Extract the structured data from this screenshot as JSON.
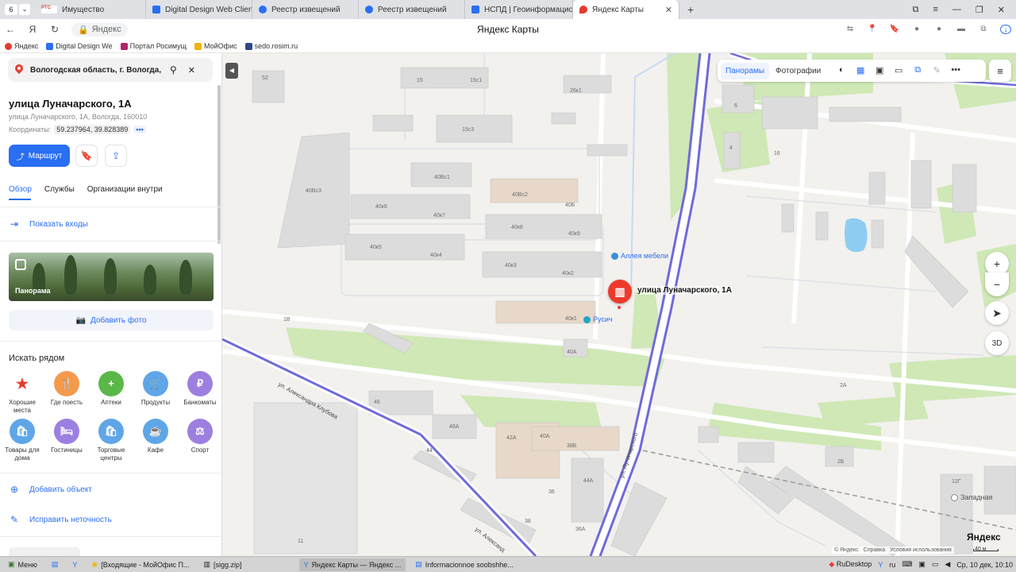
{
  "browser": {
    "tab_count": "6",
    "tabs": [
      {
        "label": "Имущество",
        "icon_color": "#d83a2b",
        "icon_text": "РТС"
      },
      {
        "label": "Digital Design Web Client",
        "icon_color": "#2a6ef2"
      },
      {
        "label": "Реестр извещений",
        "icon_color": "#2a6ef2"
      },
      {
        "label": "Реестр извещений",
        "icon_color": "#2a6ef2"
      },
      {
        "label": "НСПД | Геоинформацион",
        "icon_color": "#2a6ef2"
      },
      {
        "label": "Яндекс Карты",
        "icon_color": "#e63a2e"
      }
    ],
    "domain": "Яндекс",
    "page_title": "Яндекс Карты",
    "bookmarks": [
      {
        "label": "Яндекс",
        "color": "#e63a2e"
      },
      {
        "label": "Digital Design We",
        "color": "#2a6ef2"
      },
      {
        "label": "Портал Росимущ",
        "color": "#b0246a"
      },
      {
        "label": "МойОфис",
        "color": "#f0b400"
      },
      {
        "label": "sedo.rosim.ru",
        "color": "#2b4a8a"
      }
    ]
  },
  "sidebar": {
    "search_value": "Вологодская область, г. Вологда, ул.",
    "title": "улица Луначарского, 1А",
    "subaddress": "улица Луначарского, 1А, Вологда, 160010",
    "coords_label": "Координаты:",
    "coords_value": "59.237964, 39.828389",
    "coords_more": "•••",
    "route_label": "Маршрут",
    "tabs": [
      "Обзор",
      "Службы",
      "Организации внутри"
    ],
    "show_entrances": "Показать входы",
    "panorama_label": "Панорама",
    "add_photo": "Добавить фото",
    "nearby_title": "Искать рядом",
    "categories": [
      {
        "label": "Хорошие места",
        "color": "#ffffff",
        "glyph": "★"
      },
      {
        "label": "Где поесть",
        "color": "#f39a4c",
        "glyph": "🍴"
      },
      {
        "label": "Аптеки",
        "color": "#59b847",
        "glyph": "+"
      },
      {
        "label": "Продукты",
        "color": "#5fa6e8",
        "glyph": "🛒"
      },
      {
        "label": "Банкоматы",
        "color": "#9c7fe0",
        "glyph": "₽"
      },
      {
        "label": "Товары для дома",
        "color": "#5fa6e8",
        "glyph": "🛍"
      },
      {
        "label": "Гостиницы",
        "color": "#9c7fe0",
        "glyph": "🛏"
      },
      {
        "label": "Торговые центры",
        "color": "#5fa6e8",
        "glyph": "🛍"
      },
      {
        "label": "Кафе",
        "color": "#5fa6e8",
        "glyph": "☕"
      },
      {
        "label": "Спорт",
        "color": "#9c7fe0",
        "glyph": "⚖"
      }
    ],
    "add_object": "Добавить объект",
    "fix_error": "Исправить неточность"
  },
  "map": {
    "toolbar": {
      "panoramas": "Панорамы",
      "photos": "Фотографии"
    },
    "marker_label": "улица Луначарского, 1А",
    "pois": [
      {
        "label": "Аллея мебели"
      },
      {
        "label": "Русич"
      },
      {
        "label": "Западная"
      }
    ],
    "street_labels": [
      "ул. Александра Клубова",
      "ул. Луначарского",
      "ул. Александ"
    ],
    "building_labels": [
      "52",
      "15",
      "15с1",
      "26к1",
      "15с3",
      "40Вс3",
      "40Вс1",
      "40Вс2",
      "40Б",
      "40к6",
      "40к7",
      "40к8",
      "40к9",
      "40к5",
      "40к4",
      "40к3",
      "40к2",
      "40к1",
      "40А",
      "1В",
      "6",
      "4",
      "16",
      "2А",
      "46",
      "46А",
      "42А",
      "40А",
      "38Б",
      "44",
      "44А",
      "36",
      "38",
      "36А",
      "11",
      "2Б",
      "12Г"
    ],
    "zoom_in": "+",
    "zoom_out": "−",
    "view_3d": "3D",
    "attribution": [
      "© Яндекс",
      "Справка",
      "Условия использования"
    ],
    "scale": "40 м",
    "logo": "Яндекс"
  },
  "taskbar": {
    "menu": "Меню",
    "items": [
      "[Входящие - МойОфис П...",
      "[sigg.zip]",
      "Яндекс Карты — Яндекс ...",
      "Informacionnoe soobshhe..."
    ],
    "rudesktop": "RuDesktop",
    "lang": "ru",
    "clock": "Ср, 10 дек, 10:10"
  }
}
